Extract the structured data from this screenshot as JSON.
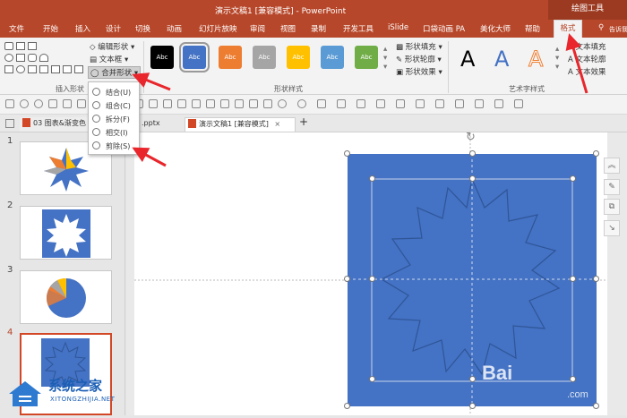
{
  "title_bar": {
    "title": "演示文稿1 [兼容模式] - PowerPoint",
    "context_label": "绘图工具"
  },
  "tabs": [
    "文件",
    "开始",
    "插入",
    "设计",
    "切换",
    "动画",
    "幻灯片放映",
    "审阅",
    "视图",
    "录制",
    "开发工具",
    "iSlide",
    "口袋动画 PA",
    "美化大师",
    "帮助"
  ],
  "active_tab": "格式",
  "search_label": "告诉我",
  "ribbon": {
    "insert_shapes": {
      "edit_shape": "编辑形状",
      "text_box": "文本框",
      "merge_shapes": "合并形状",
      "label": "插入形状"
    },
    "shape_styles": {
      "swatches": [
        {
          "text": "Abc",
          "color": "#000000"
        },
        {
          "text": "Abc",
          "color": "#4472c4"
        },
        {
          "text": "Abc",
          "color": "#ed7d31"
        },
        {
          "text": "Abc",
          "color": "#a5a5a5"
        },
        {
          "text": "Abc",
          "color": "#ffc000"
        },
        {
          "text": "Abc",
          "color": "#5b9bd5"
        },
        {
          "text": "Abc",
          "color": "#70ad47"
        }
      ],
      "fill": "形状填充",
      "outline": "形状轮廓",
      "effects": "形状效果",
      "label": "形状样式"
    },
    "wordart": {
      "letters": [
        "A",
        "A",
        "A"
      ],
      "text_fill": "文本填充",
      "text_outline": "文本轮廓",
      "text_effects": "文本效果",
      "label": "艺术字样式"
    }
  },
  "merge_menu": [
    "结合(U)",
    "组合(C)",
    "拆分(F)",
    "相交(I)",
    "剪除(S)"
  ],
  "doc_tabs": [
    {
      "label": "03 图表&渐变色",
      "active": false
    },
    {
      "label": ".pptx",
      "active": false
    },
    {
      "label": "演示文稿1 [兼容模式]",
      "active": true
    }
  ],
  "slides": [
    {
      "number": "1"
    },
    {
      "number": "2"
    },
    {
      "number": "3"
    },
    {
      "number": "4"
    }
  ],
  "colors": {
    "accent": "#b7472a",
    "shape_fill": "#4472c4",
    "arrow": "#e8262c"
  },
  "watermark": {
    "site_name": "系统之家",
    "url": "XITONGZHIJIA.NET",
    "baidu": "Bai",
    "baidu_suffix": ".com"
  }
}
